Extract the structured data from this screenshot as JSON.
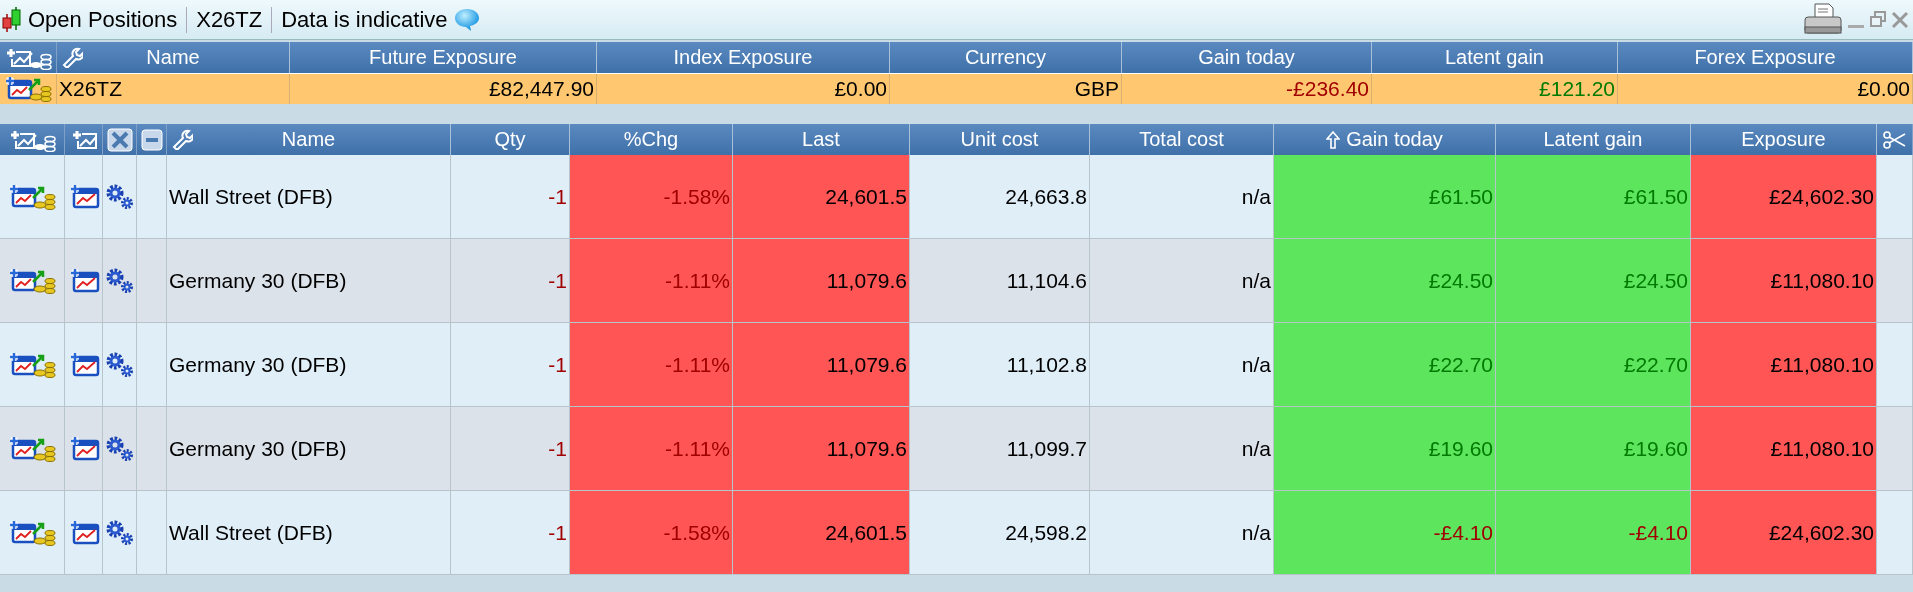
{
  "title_bar": {
    "title": "Open Positions",
    "account": "X26TZ",
    "notice": "Data is indicative"
  },
  "summary": {
    "columns": [
      {
        "label": "Name"
      },
      {
        "label": "Future Exposure"
      },
      {
        "label": "Index Exposure"
      },
      {
        "label": "Currency"
      },
      {
        "label": "Gain today"
      },
      {
        "label": "Latent gain"
      },
      {
        "label": "Forex Exposure"
      }
    ],
    "row": {
      "name": "X26TZ",
      "cells": [
        {
          "text": "£82,447.90",
          "loss": false,
          "gain": false
        },
        {
          "text": "£0.00",
          "loss": false,
          "gain": false
        },
        {
          "text": "GBP",
          "loss": false,
          "gain": false
        },
        {
          "text": "-£236.40",
          "loss": true,
          "gain": false
        },
        {
          "text": "£121.20",
          "loss": false,
          "gain": true
        },
        {
          "text": "£0.00",
          "loss": false,
          "gain": false
        }
      ]
    }
  },
  "positions": {
    "columns": [
      {
        "label": "Name",
        "sorted": false
      },
      {
        "label": "Qty",
        "sorted": false
      },
      {
        "label": "%Chg",
        "sorted": false
      },
      {
        "label": "Last",
        "sorted": false
      },
      {
        "label": "Unit cost",
        "sorted": false
      },
      {
        "label": "Total cost",
        "sorted": false
      },
      {
        "label": "Gain today",
        "sorted": true
      },
      {
        "label": "Latent gain",
        "sorted": false
      },
      {
        "label": "Exposure",
        "sorted": false
      }
    ],
    "rows": [
      {
        "name": "Wall Street (DFB)",
        "cells": [
          {
            "text": "-1",
            "loss": true,
            "gain": false
          },
          {
            "text": "-1.58%",
            "loss": true,
            "gain": false,
            "color": "#ff5555"
          },
          {
            "text": "24,601.5",
            "loss": false,
            "gain": false,
            "color": "#ff5555"
          },
          {
            "text": "24,663.8",
            "loss": false,
            "gain": false
          },
          {
            "text": "n/a",
            "loss": false,
            "gain": false
          },
          {
            "text": "£61.50",
            "loss": false,
            "gain": true,
            "color": "#5de55d"
          },
          {
            "text": "£61.50",
            "loss": false,
            "gain": true,
            "color": "#5de55d"
          },
          {
            "text": "£24,602.30",
            "loss": false,
            "gain": false,
            "color": "#ff5555"
          }
        ]
      },
      {
        "name": "Germany 30 (DFB)",
        "cells": [
          {
            "text": "-1",
            "loss": true,
            "gain": false
          },
          {
            "text": "-1.11%",
            "loss": true,
            "gain": false,
            "color": "#ff5555"
          },
          {
            "text": "11,079.6",
            "loss": false,
            "gain": false,
            "color": "#ff5555"
          },
          {
            "text": "11,104.6",
            "loss": false,
            "gain": false
          },
          {
            "text": "n/a",
            "loss": false,
            "gain": false
          },
          {
            "text": "£24.50",
            "loss": false,
            "gain": true,
            "color": "#5de55d"
          },
          {
            "text": "£24.50",
            "loss": false,
            "gain": true,
            "color": "#5de55d"
          },
          {
            "text": "£11,080.10",
            "loss": false,
            "gain": false,
            "color": "#ff5555"
          }
        ]
      },
      {
        "name": "Germany 30 (DFB)",
        "cells": [
          {
            "text": "-1",
            "loss": true,
            "gain": false
          },
          {
            "text": "-1.11%",
            "loss": true,
            "gain": false,
            "color": "#ff5555"
          },
          {
            "text": "11,079.6",
            "loss": false,
            "gain": false,
            "color": "#ff5555"
          },
          {
            "text": "11,102.8",
            "loss": false,
            "gain": false
          },
          {
            "text": "n/a",
            "loss": false,
            "gain": false
          },
          {
            "text": "£22.70",
            "loss": false,
            "gain": true,
            "color": "#5de55d"
          },
          {
            "text": "£22.70",
            "loss": false,
            "gain": true,
            "color": "#5de55d"
          },
          {
            "text": "£11,080.10",
            "loss": false,
            "gain": false,
            "color": "#ff5555"
          }
        ]
      },
      {
        "name": "Germany 30 (DFB)",
        "cells": [
          {
            "text": "-1",
            "loss": true,
            "gain": false
          },
          {
            "text": "-1.11%",
            "loss": true,
            "gain": false,
            "color": "#ff5555"
          },
          {
            "text": "11,079.6",
            "loss": false,
            "gain": false,
            "color": "#ff5555"
          },
          {
            "text": "11,099.7",
            "loss": false,
            "gain": false
          },
          {
            "text": "n/a",
            "loss": false,
            "gain": false
          },
          {
            "text": "£19.60",
            "loss": false,
            "gain": true,
            "color": "#5de55d"
          },
          {
            "text": "£19.60",
            "loss": false,
            "gain": true,
            "color": "#5de55d"
          },
          {
            "text": "£11,080.10",
            "loss": false,
            "gain": false,
            "color": "#ff5555"
          }
        ]
      },
      {
        "name": "Wall Street (DFB)",
        "cells": [
          {
            "text": "-1",
            "loss": true,
            "gain": false
          },
          {
            "text": "-1.58%",
            "loss": true,
            "gain": false,
            "color": "#ff5555"
          },
          {
            "text": "24,601.5",
            "loss": false,
            "gain": false,
            "color": "#ff5555"
          },
          {
            "text": "24,598.2",
            "loss": false,
            "gain": false
          },
          {
            "text": "n/a",
            "loss": false,
            "gain": false
          },
          {
            "text": "-£4.10",
            "loss": true,
            "gain": false,
            "color": "#5de55d"
          },
          {
            "text": "-£4.10",
            "loss": true,
            "gain": false,
            "color": "#5de55d"
          },
          {
            "text": "£24,602.30",
            "loss": false,
            "gain": false,
            "color": "#ff5555"
          }
        ]
      }
    ]
  }
}
